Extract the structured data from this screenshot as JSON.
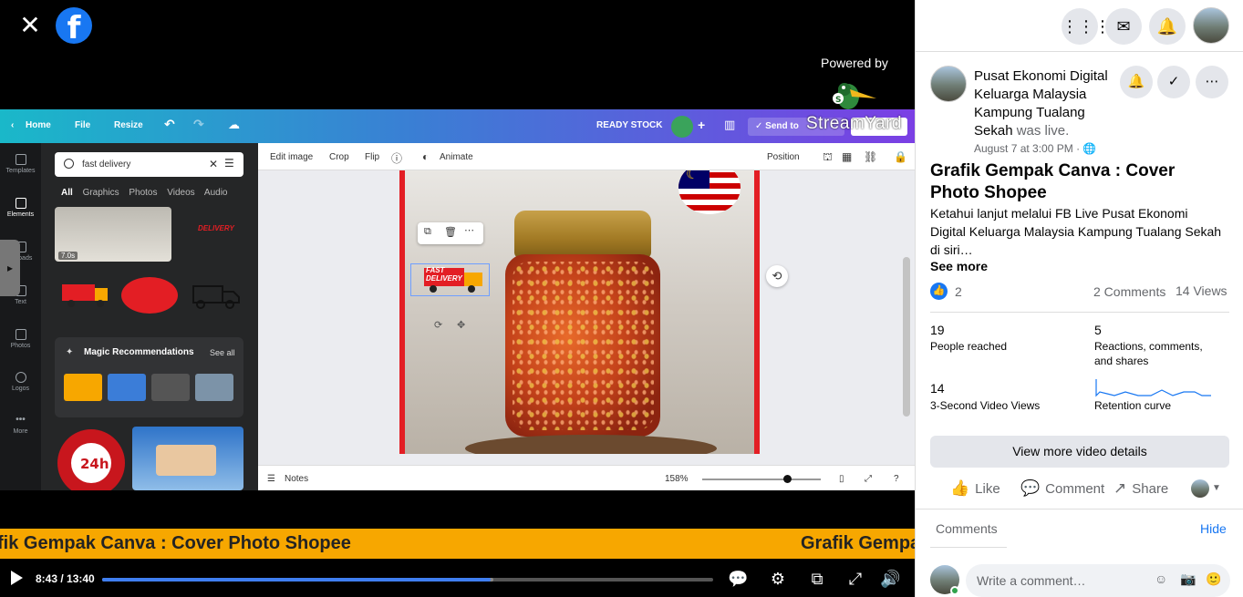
{
  "video": {
    "powered_by": "Powered by",
    "streamyard": "StreamYard",
    "ticker_main": "fik Gempak Canva : Cover Photo Shopee",
    "ticker_repeat": "Grafik Gempak",
    "time": "8:43 / 13:40",
    "progress_fraction": 0.636,
    "buffered_fraction": 0.64
  },
  "canva": {
    "nav": {
      "home": "Home",
      "file": "File",
      "resize": "Resize",
      "ready_stock": "READY STOCK",
      "send": "Send to"
    },
    "sidebar": [
      "Templates",
      "Elements",
      "Uploads",
      "Text",
      "Photos",
      "Logos",
      "More"
    ],
    "search_value": "fast delivery",
    "tabs": [
      "All",
      "Graphics",
      "Photos",
      "Videos",
      "Audio"
    ],
    "video_dur": "7.0s",
    "delivery_text": "DELIVERY",
    "fast_delivery": "FAST DELIVERY",
    "magic": {
      "title": "Magic Recommendations",
      "see_all": "See all"
    },
    "toolbar": {
      "edit_image": "Edit image",
      "crop": "Crop",
      "flip": "Flip",
      "animate": "Animate",
      "position": "Position"
    },
    "bottom": {
      "notes": "Notes",
      "zoom": "158%"
    }
  },
  "sidebar": {
    "page_name": "Pusat Ekonomi Digital Keluarga Malaysia Kampung Tualang Sekah",
    "was_live": "was live.",
    "date": "August 7 at 3:00 PM · ",
    "post_title": "Grafik Gempak Canva : Cover Photo Shopee",
    "post_desc": "Ketahui lanjut melalui FB Live Pusat Ekonomi Digital Keluarga Malaysia Kampung Tualang Sekah di siri…",
    "see_more": "See more",
    "like_count": "2",
    "comments": "2 Comments",
    "views": "14 Views",
    "stats": {
      "reached_n": "19",
      "reached_l": "People reached",
      "react_n": "5",
      "react_l": "Reactions, comments, and shares",
      "v3_n": "14",
      "v3_l": "3-Second Video Views",
      "retention_l": "Retention curve"
    },
    "view_more": "View more video details",
    "actions": {
      "like": "Like",
      "comment": "Comment",
      "share": "Share"
    },
    "comments_hdr": "Comments",
    "hide": "Hide",
    "write_placeholder": "Write a comment…"
  }
}
